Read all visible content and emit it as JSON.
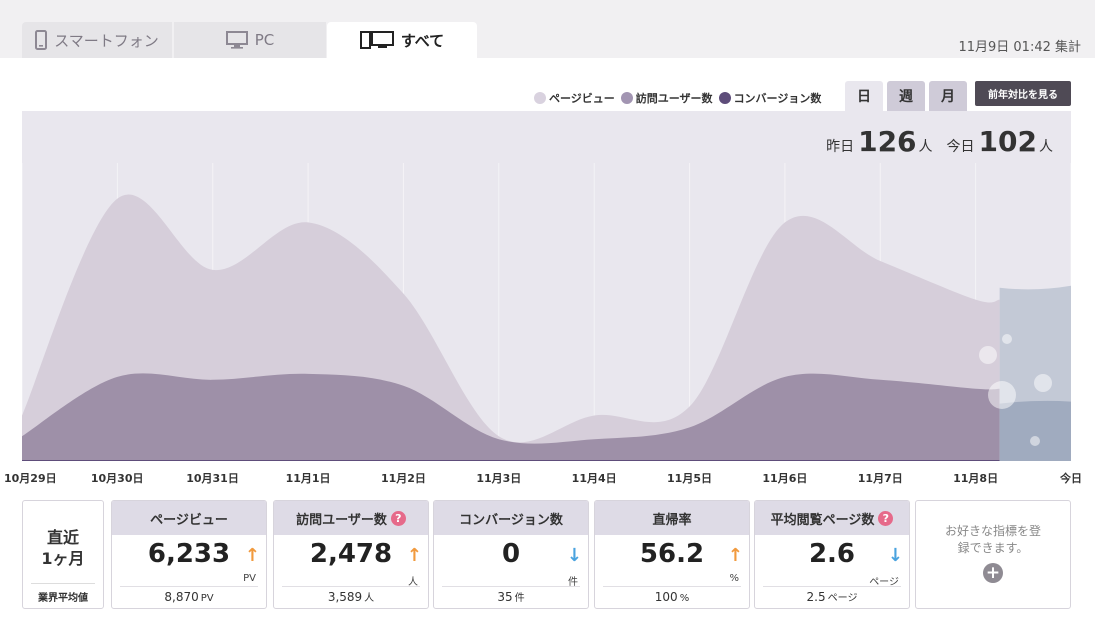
{
  "tabs": [
    {
      "label": "スマートフォン",
      "icon": "smartphone-icon",
      "active": false
    },
    {
      "label": "PC",
      "icon": "monitor-icon",
      "active": false
    },
    {
      "label": "すべて",
      "icon": "phone-and-monitor-icon",
      "active": true
    }
  ],
  "aggregated_at": "11月9日 01:42 集計",
  "legend": [
    {
      "label": "ページビュー",
      "color": "#d9d2df"
    },
    {
      "label": "訪問ユーザー数",
      "color": "#a295b2"
    },
    {
      "label": "コンバージョン数",
      "color": "#5e4d7a"
    }
  ],
  "period_buttons": [
    {
      "label": "日",
      "active": true
    },
    {
      "label": "週",
      "active": false
    },
    {
      "label": "月",
      "active": false
    }
  ],
  "yoy_button": "前年対比を見る",
  "summary": {
    "yesterday_label": "昨日",
    "yesterday_value": "126",
    "yesterday_unit": "人",
    "today_label": "今日",
    "today_value": "102",
    "today_unit": "人"
  },
  "chart_data": {
    "type": "area",
    "x": [
      "10月29日",
      "10月30日",
      "10月31日",
      "11月1日",
      "11月2日",
      "11月3日",
      "11月4日",
      "11月5日",
      "11月6日",
      "11月7日",
      "11月8日",
      "今日"
    ],
    "series": [
      {
        "name": "ページビュー",
        "values": [
          15,
          88,
          64,
          80,
          56,
          8,
          15,
          18,
          80,
          67,
          54,
          58
        ]
      },
      {
        "name": "訪問ユーザー数",
        "values": [
          8,
          28,
          27,
          29,
          25,
          7,
          7,
          11,
          28,
          27,
          24,
          19
        ]
      },
      {
        "name": "コンバージョン数",
        "values": [
          0,
          0,
          0,
          0,
          0,
          0,
          0,
          0,
          0,
          0,
          0,
          0
        ]
      }
    ],
    "ylim": [
      0,
      100
    ],
    "today_partial": true
  },
  "period": {
    "line1": "直近",
    "line2": "1ヶ月",
    "benchmark_label": "業界平均値"
  },
  "metrics": [
    {
      "title": "ページビュー",
      "help": false,
      "value": "6,233",
      "trend": "up",
      "unit": "PV",
      "bench": "8,870",
      "bench_unit": "PV"
    },
    {
      "title": "訪問ユーザー数",
      "help": true,
      "value": "2,478",
      "trend": "up",
      "unit": "人",
      "bench": "3,589",
      "bench_unit": "人"
    },
    {
      "title": "コンバージョン数",
      "help": false,
      "value": "0",
      "trend": "down",
      "unit": "件",
      "bench": "35",
      "bench_unit": "件"
    },
    {
      "title": "直帰率",
      "help": false,
      "value": "56.2",
      "trend": "up",
      "unit": "%",
      "bench": "100",
      "bench_unit": "%"
    },
    {
      "title": "平均閲覧ページ数",
      "help": true,
      "value": "2.6",
      "trend": "down",
      "unit": "ページ",
      "bench": "2.5",
      "bench_unit": "ページ"
    }
  ],
  "add_card": {
    "text": "お好きな指標を登録できます。",
    "icon": "plus-circle-icon"
  }
}
